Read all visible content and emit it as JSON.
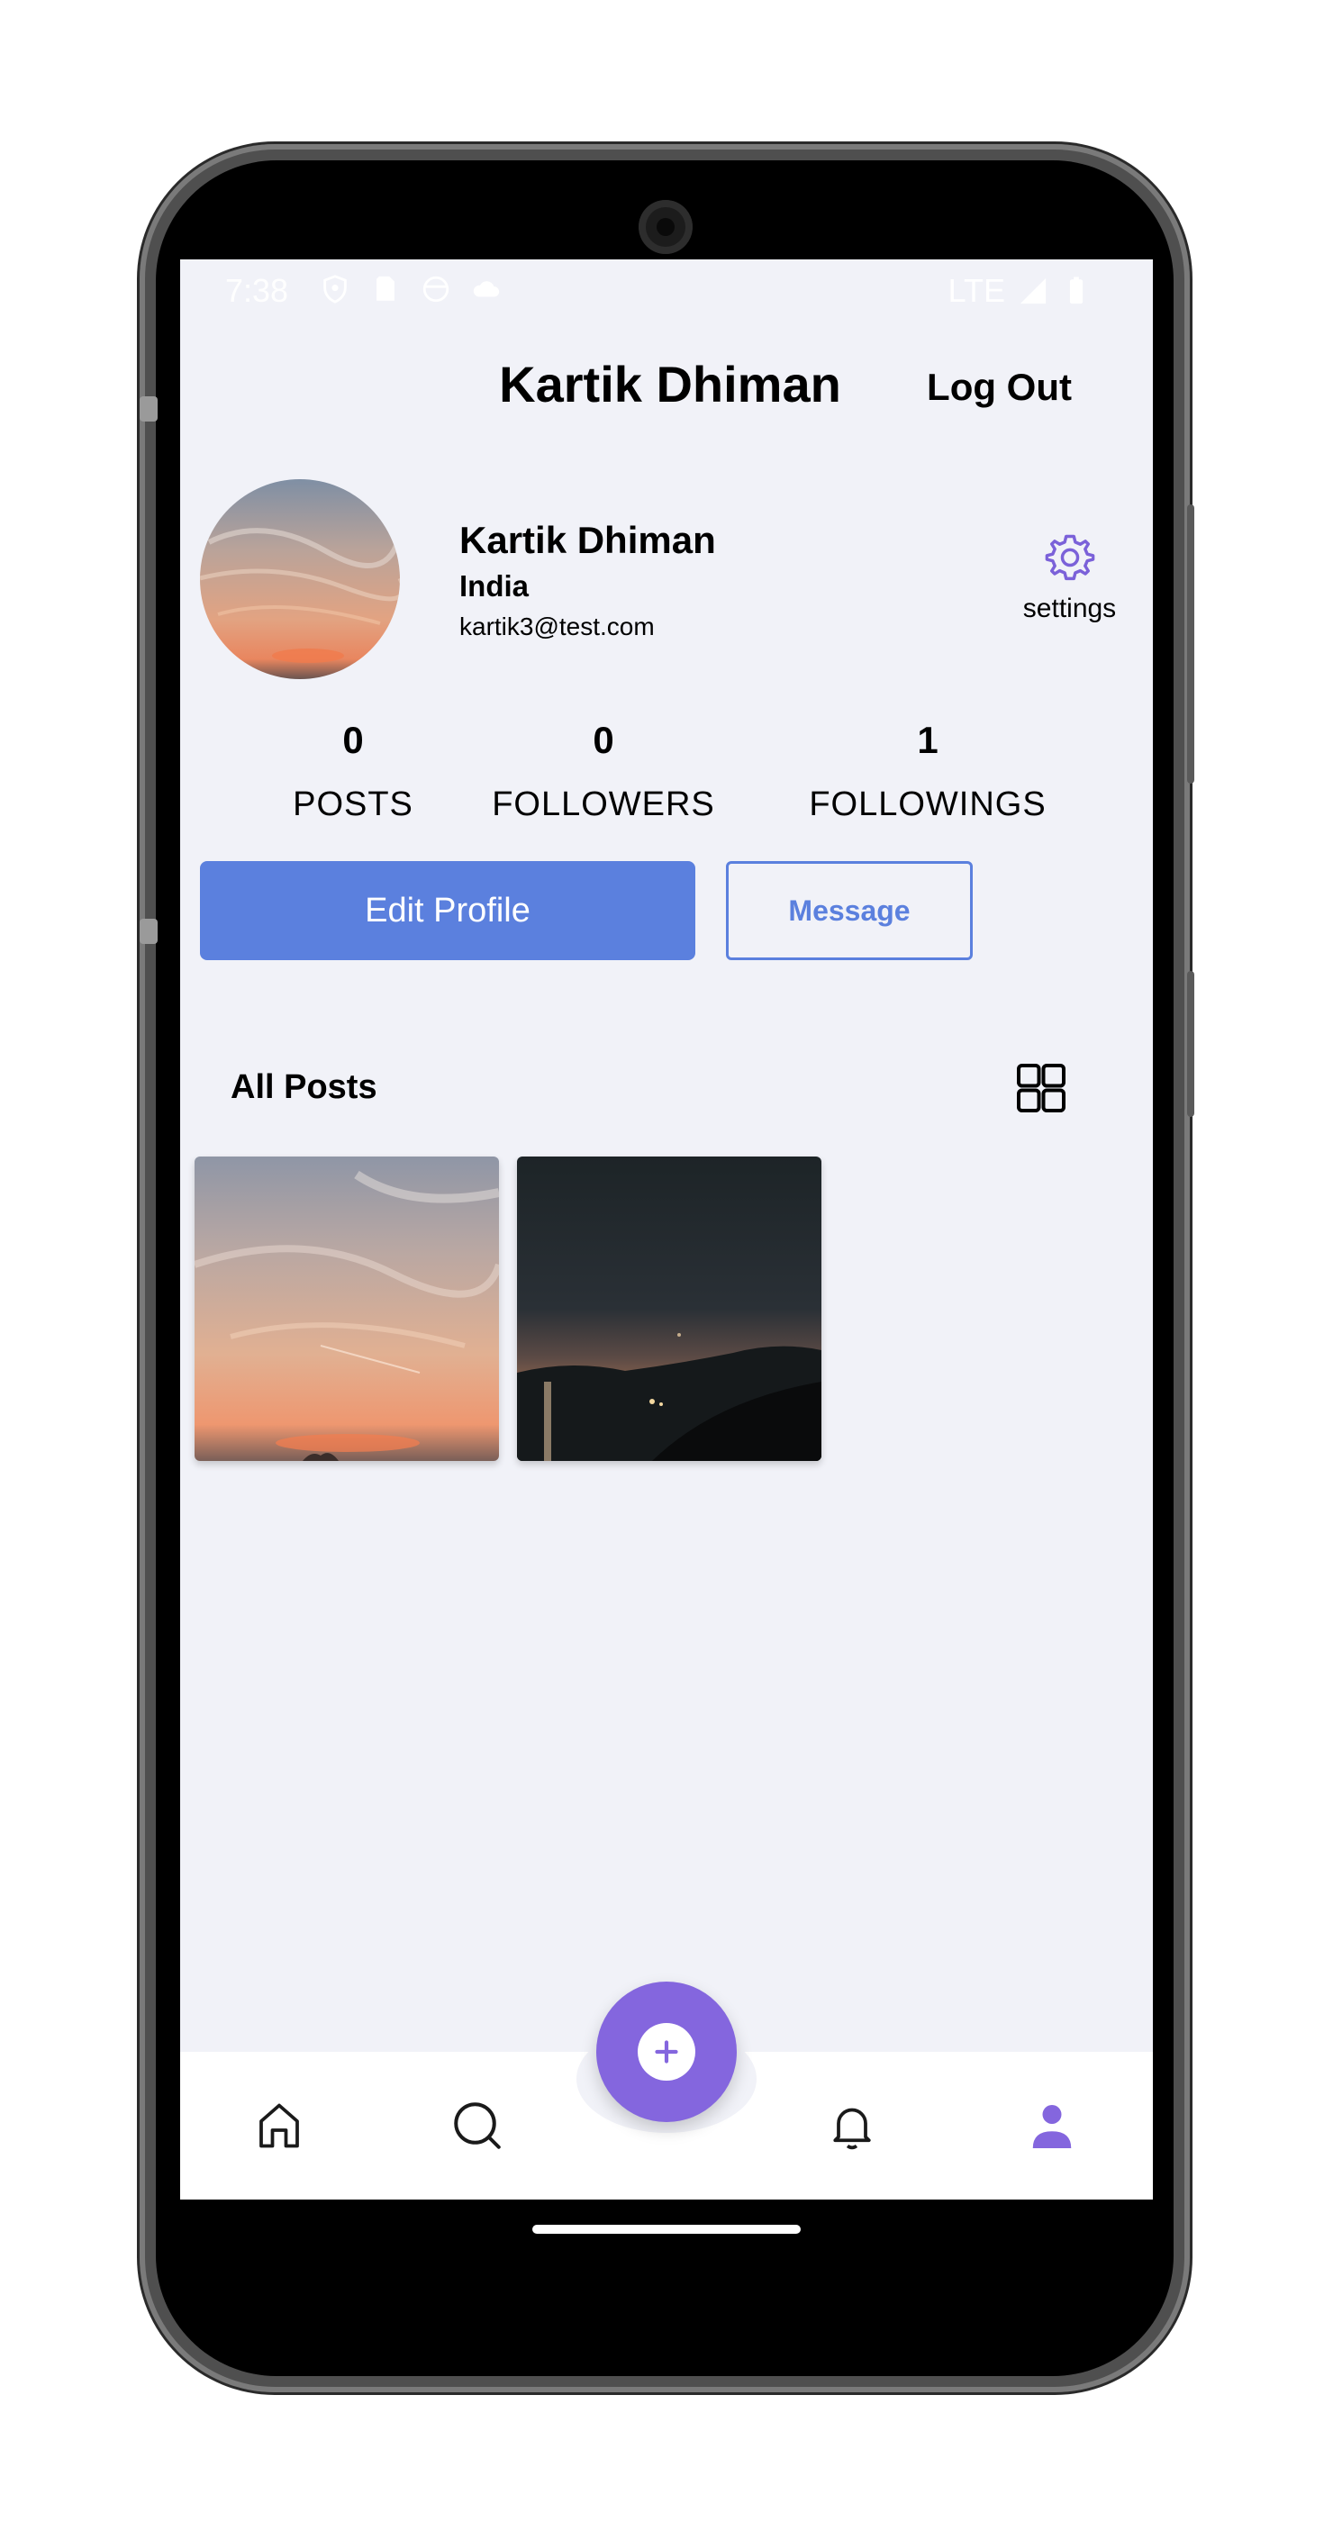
{
  "status_bar": {
    "time": "7:38",
    "network": "LTE",
    "left_icons": [
      "shield-icon",
      "sim-card-icon",
      "face-icon",
      "cloud-icon"
    ],
    "right_icons": [
      "signal-icon",
      "battery-icon"
    ]
  },
  "header": {
    "title": "Kartik Dhiman",
    "logout_label": "Log Out"
  },
  "profile": {
    "name": "Kartik Dhiman",
    "country": "India",
    "email": "kartik3@test.com",
    "settings_label": "settings"
  },
  "stats": [
    {
      "value": "0",
      "label": "POSTS"
    },
    {
      "value": "0",
      "label": "FOLLOWERS"
    },
    {
      "value": "1",
      "label": "FOLLOWINGS"
    }
  ],
  "actions": {
    "edit_profile_label": "Edit Profile",
    "message_label": "Message"
  },
  "posts_section": {
    "title": "All Posts",
    "view_icon": "grid-view-icon",
    "posts": [
      {
        "kind": "sunset-sky-photo"
      },
      {
        "kind": "night-landscape-photo"
      }
    ]
  },
  "bottom_nav": {
    "items": [
      "home-icon",
      "search-icon",
      "add-icon",
      "bell-icon",
      "profile-icon"
    ],
    "active": "profile-icon"
  },
  "colors": {
    "screen_background": "#f1f2f8",
    "primary_blue": "#5b80de",
    "accent_purple": "#8466de",
    "text": "#000000"
  }
}
